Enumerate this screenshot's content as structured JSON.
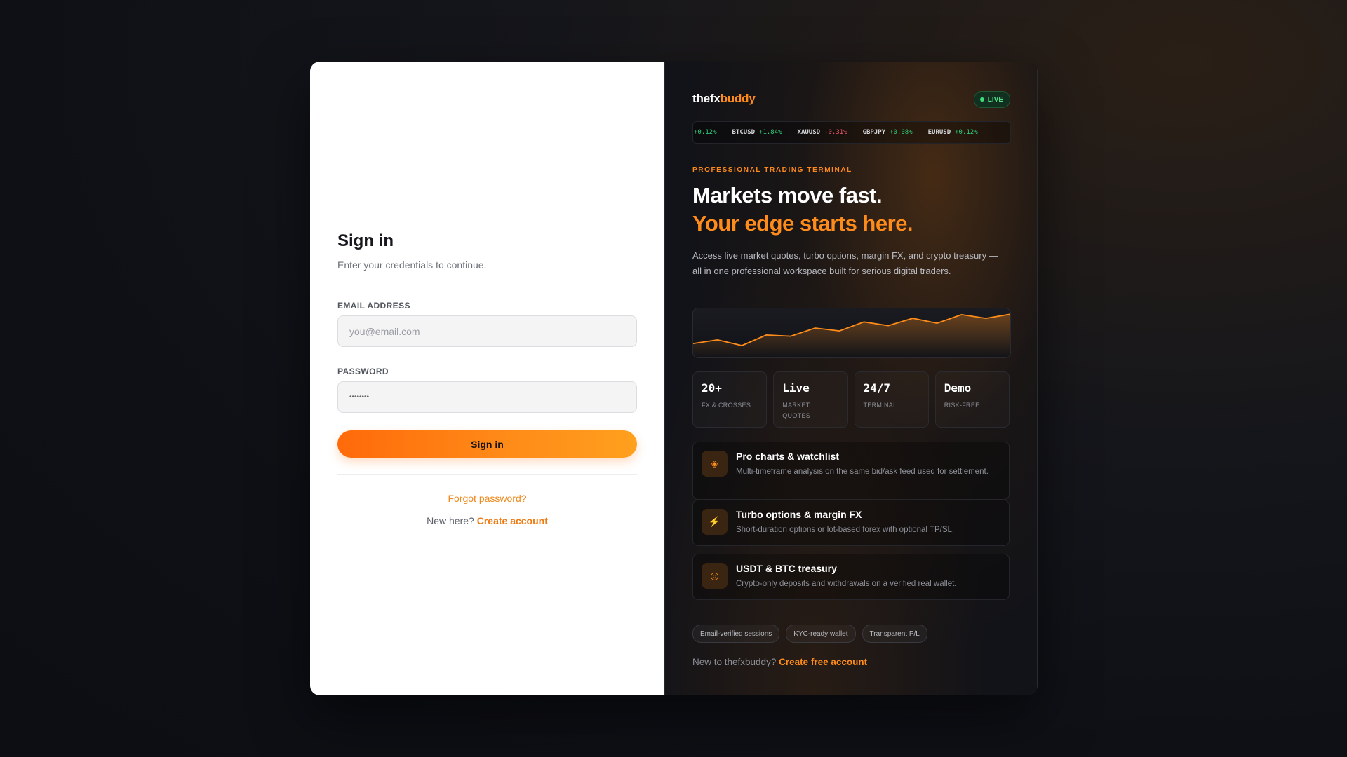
{
  "signin": {
    "title": "Sign in",
    "subtitle": "Enter your credentials to continue.",
    "email_label": "EMAIL ADDRESS",
    "email_placeholder": "you@email.com",
    "email_value": "",
    "password_label": "PASSWORD",
    "password_value": "••••••••",
    "submit_label": "Sign in",
    "forgot_label": "Forgot password?",
    "new_here_text": "New here?",
    "create_account_label": "Create account"
  },
  "promo": {
    "brand_part1": "thefx",
    "brand_part2": "buddy",
    "live_label": "LIVE",
    "ticker": [
      {
        "symbol": "",
        "change": "+0.12%",
        "direction": "up"
      },
      {
        "symbol": "BTCUSD",
        "change": "+1.84%",
        "direction": "up"
      },
      {
        "symbol": "XAUUSD",
        "change": "-0.31%",
        "direction": "down"
      },
      {
        "symbol": "GBPJPY",
        "change": "+0.08%",
        "direction": "up"
      },
      {
        "symbol": "EURUSD",
        "change": "+0.12%",
        "direction": "up"
      }
    ],
    "eyebrow": "PROFESSIONAL TRADING TERMINAL",
    "headline_line1": "Markets move fast.",
    "headline_line2": "Your edge starts here.",
    "description": "Access live market quotes, turbo options, margin FX, and crypto treasury — all in one professional workspace built for serious digital traders.",
    "stats": [
      {
        "value": "20+",
        "label": "FX & CROSSES"
      },
      {
        "value": "Live",
        "label": "MARKET QUOTES"
      },
      {
        "value": "24/7",
        "label": "TERMINAL"
      },
      {
        "value": "Demo",
        "label": "RISK-FREE"
      }
    ],
    "features": [
      {
        "icon": "diamond-icon",
        "glyph": "◈",
        "title": "Pro charts & watchlist",
        "description": "Multi-timeframe analysis on the same bid/ask feed used for settlement."
      },
      {
        "icon": "lightning-icon",
        "glyph": "⚡",
        "title": "Turbo options & margin FX",
        "description": "Short-duration options or lot-based forex with optional TP/SL."
      },
      {
        "icon": "target-icon",
        "glyph": "◎",
        "title": "USDT & BTC treasury",
        "description": "Crypto-only deposits and withdrawals on a verified real wallet."
      }
    ],
    "chips": [
      "Email-verified sessions",
      "KYC-ready wallet",
      "Transparent P/L"
    ],
    "bottom_text": "New to thefxbuddy?",
    "bottom_link": "Create free account"
  },
  "colors": {
    "accent": "#ff8c1a",
    "up": "#2fd07a",
    "down": "#f0566a"
  },
  "sparkline": {
    "values": [
      0.24,
      0.33,
      0.19,
      0.45,
      0.42,
      0.62,
      0.55,
      0.77,
      0.68,
      0.86,
      0.74,
      0.95,
      0.86,
      0.96
    ]
  }
}
